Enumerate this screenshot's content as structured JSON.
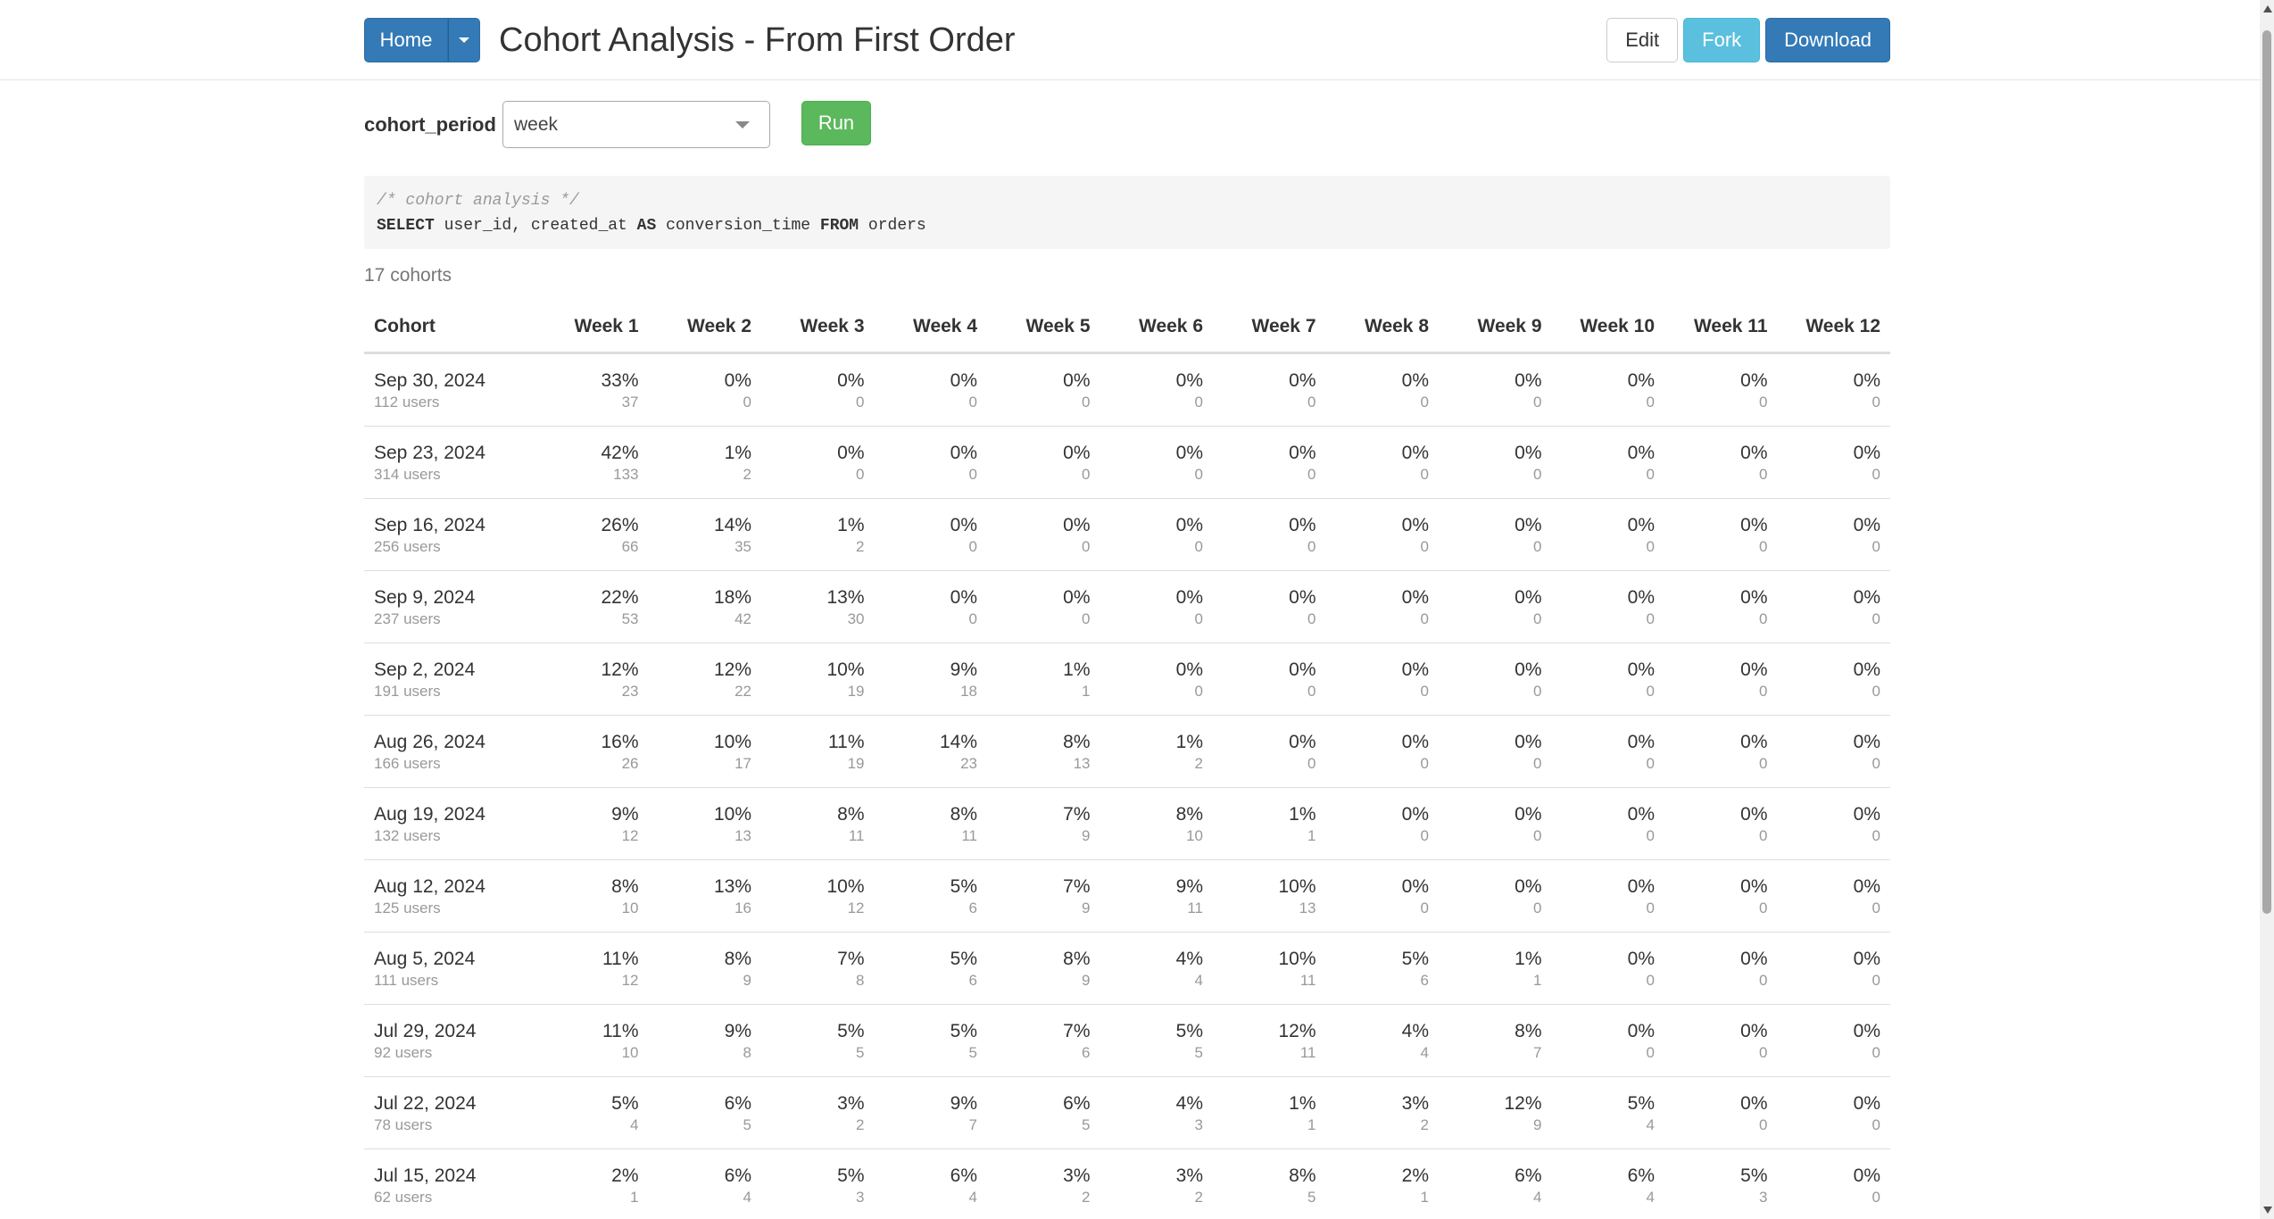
{
  "header": {
    "home_label": "Home",
    "title": "Cohort Analysis - From First Order",
    "edit_label": "Edit",
    "fork_label": "Fork",
    "download_label": "Download"
  },
  "form": {
    "param_label": "cohort_period",
    "selected_value": "week",
    "run_label": "Run"
  },
  "query": {
    "comment": "/* cohort analysis */",
    "kw_select": "SELECT",
    "cols": " user_id, created_at ",
    "kw_as": "AS",
    "alias": " conversion_time ",
    "kw_from": "FROM",
    "table": " orders"
  },
  "summary": {
    "cohort_count": "17 cohorts"
  },
  "table": {
    "headers": [
      "Cohort",
      "Week 1",
      "Week 2",
      "Week 3",
      "Week 4",
      "Week 5",
      "Week 6",
      "Week 7",
      "Week 8",
      "Week 9",
      "Week 10",
      "Week 11",
      "Week 12"
    ],
    "rows": [
      {
        "date": "Sep 30, 2024",
        "users": "112 users",
        "pct": [
          "33%",
          "0%",
          "0%",
          "0%",
          "0%",
          "0%",
          "0%",
          "0%",
          "0%",
          "0%",
          "0%",
          "0%"
        ],
        "counts": [
          "37",
          "0",
          "0",
          "0",
          "0",
          "0",
          "0",
          "0",
          "0",
          "0",
          "0",
          "0"
        ]
      },
      {
        "date": "Sep 23, 2024",
        "users": "314 users",
        "pct": [
          "42%",
          "1%",
          "0%",
          "0%",
          "0%",
          "0%",
          "0%",
          "0%",
          "0%",
          "0%",
          "0%",
          "0%"
        ],
        "counts": [
          "133",
          "2",
          "0",
          "0",
          "0",
          "0",
          "0",
          "0",
          "0",
          "0",
          "0",
          "0"
        ]
      },
      {
        "date": "Sep 16, 2024",
        "users": "256 users",
        "pct": [
          "26%",
          "14%",
          "1%",
          "0%",
          "0%",
          "0%",
          "0%",
          "0%",
          "0%",
          "0%",
          "0%",
          "0%"
        ],
        "counts": [
          "66",
          "35",
          "2",
          "0",
          "0",
          "0",
          "0",
          "0",
          "0",
          "0",
          "0",
          "0"
        ]
      },
      {
        "date": "Sep 9, 2024",
        "users": "237 users",
        "pct": [
          "22%",
          "18%",
          "13%",
          "0%",
          "0%",
          "0%",
          "0%",
          "0%",
          "0%",
          "0%",
          "0%",
          "0%"
        ],
        "counts": [
          "53",
          "42",
          "30",
          "0",
          "0",
          "0",
          "0",
          "0",
          "0",
          "0",
          "0",
          "0"
        ]
      },
      {
        "date": "Sep 2, 2024",
        "users": "191 users",
        "pct": [
          "12%",
          "12%",
          "10%",
          "9%",
          "1%",
          "0%",
          "0%",
          "0%",
          "0%",
          "0%",
          "0%",
          "0%"
        ],
        "counts": [
          "23",
          "22",
          "19",
          "18",
          "1",
          "0",
          "0",
          "0",
          "0",
          "0",
          "0",
          "0"
        ]
      },
      {
        "date": "Aug 26, 2024",
        "users": "166 users",
        "pct": [
          "16%",
          "10%",
          "11%",
          "14%",
          "8%",
          "1%",
          "0%",
          "0%",
          "0%",
          "0%",
          "0%",
          "0%"
        ],
        "counts": [
          "26",
          "17",
          "19",
          "23",
          "13",
          "2",
          "0",
          "0",
          "0",
          "0",
          "0",
          "0"
        ]
      },
      {
        "date": "Aug 19, 2024",
        "users": "132 users",
        "pct": [
          "9%",
          "10%",
          "8%",
          "8%",
          "7%",
          "8%",
          "1%",
          "0%",
          "0%",
          "0%",
          "0%",
          "0%"
        ],
        "counts": [
          "12",
          "13",
          "11",
          "11",
          "9",
          "10",
          "1",
          "0",
          "0",
          "0",
          "0",
          "0"
        ]
      },
      {
        "date": "Aug 12, 2024",
        "users": "125 users",
        "pct": [
          "8%",
          "13%",
          "10%",
          "5%",
          "7%",
          "9%",
          "10%",
          "0%",
          "0%",
          "0%",
          "0%",
          "0%"
        ],
        "counts": [
          "10",
          "16",
          "12",
          "6",
          "9",
          "11",
          "13",
          "0",
          "0",
          "0",
          "0",
          "0"
        ]
      },
      {
        "date": "Aug 5, 2024",
        "users": "111 users",
        "pct": [
          "11%",
          "8%",
          "7%",
          "5%",
          "8%",
          "4%",
          "10%",
          "5%",
          "1%",
          "0%",
          "0%",
          "0%"
        ],
        "counts": [
          "12",
          "9",
          "8",
          "6",
          "9",
          "4",
          "11",
          "6",
          "1",
          "0",
          "0",
          "0"
        ]
      },
      {
        "date": "Jul 29, 2024",
        "users": "92 users",
        "pct": [
          "11%",
          "9%",
          "5%",
          "5%",
          "7%",
          "5%",
          "12%",
          "4%",
          "8%",
          "0%",
          "0%",
          "0%"
        ],
        "counts": [
          "10",
          "8",
          "5",
          "5",
          "6",
          "5",
          "11",
          "4",
          "7",
          "0",
          "0",
          "0"
        ]
      },
      {
        "date": "Jul 22, 2024",
        "users": "78 users",
        "pct": [
          "5%",
          "6%",
          "3%",
          "9%",
          "6%",
          "4%",
          "1%",
          "3%",
          "12%",
          "5%",
          "0%",
          "0%"
        ],
        "counts": [
          "4",
          "5",
          "2",
          "7",
          "5",
          "3",
          "1",
          "2",
          "9",
          "4",
          "0",
          "0"
        ]
      },
      {
        "date": "Jul 15, 2024",
        "users": "62 users",
        "pct": [
          "2%",
          "6%",
          "5%",
          "6%",
          "3%",
          "3%",
          "8%",
          "2%",
          "6%",
          "6%",
          "5%",
          "0%"
        ],
        "counts": [
          "1",
          "4",
          "3",
          "4",
          "2",
          "2",
          "5",
          "1",
          "4",
          "4",
          "3",
          "0"
        ]
      }
    ]
  }
}
